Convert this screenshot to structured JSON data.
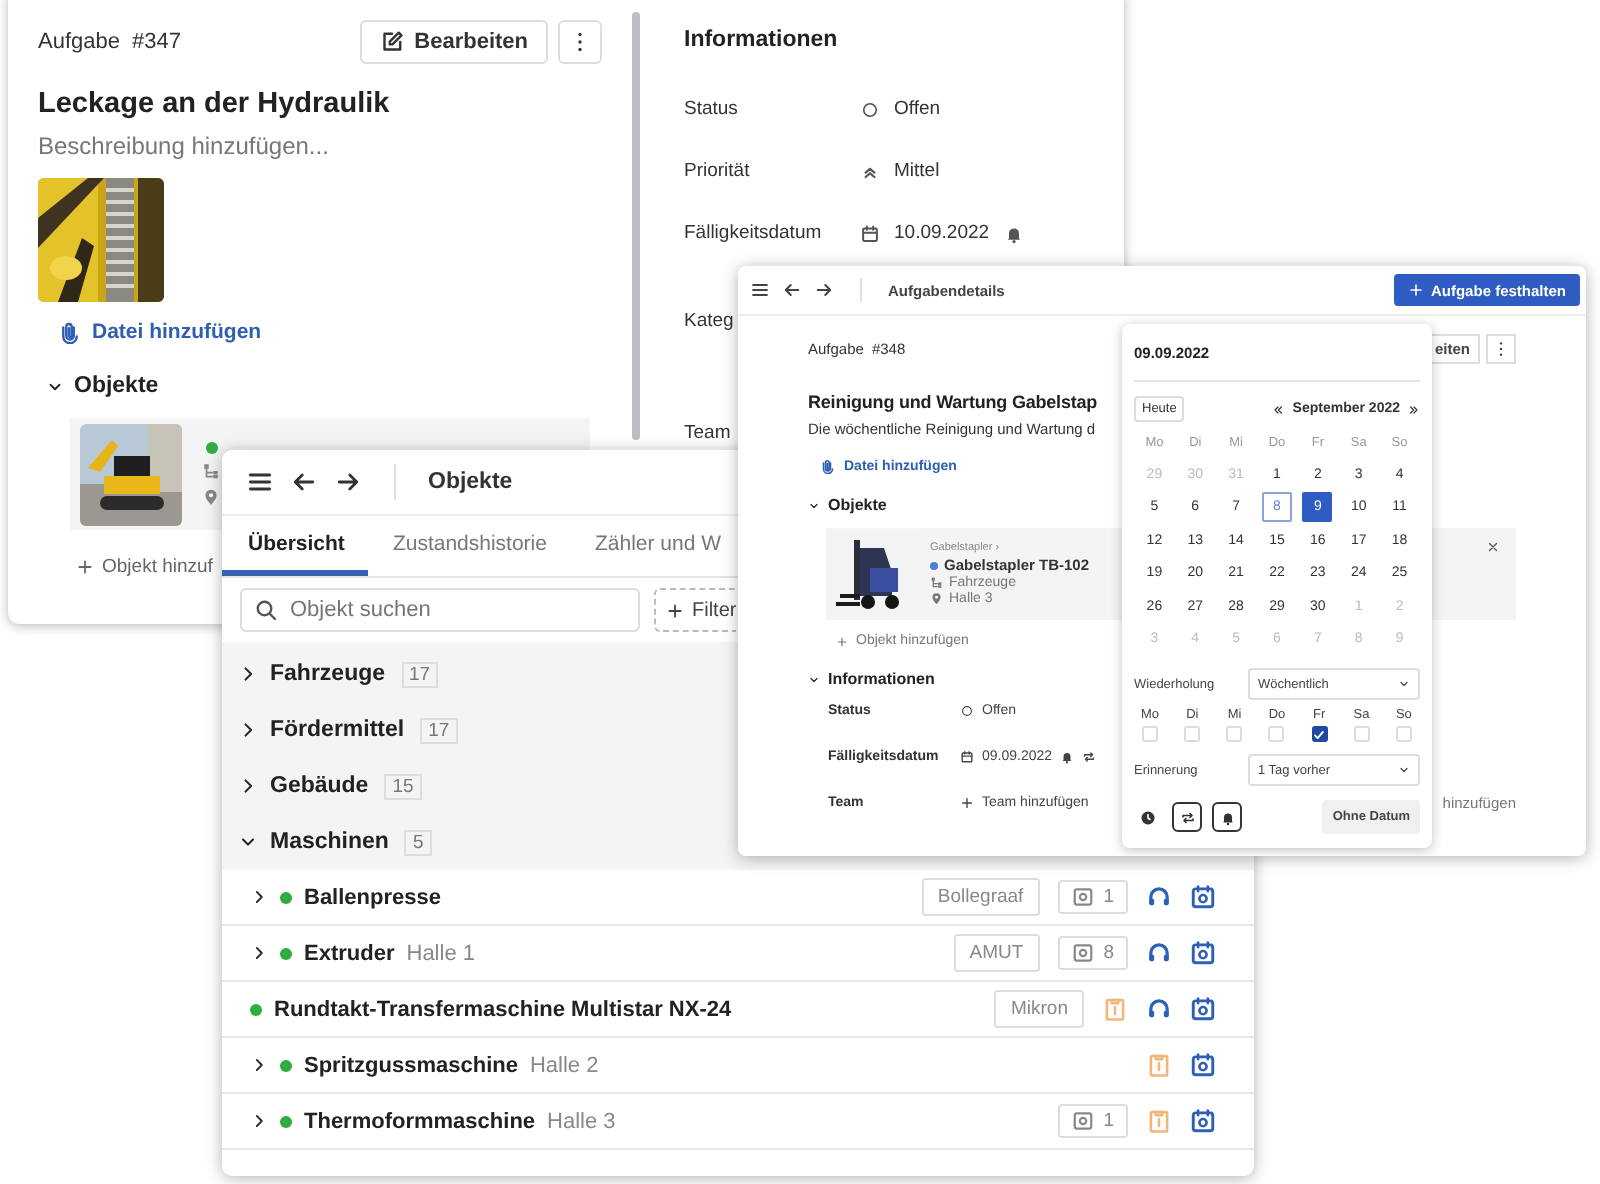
{
  "task_window": {
    "task_label": "Aufgabe",
    "task_number": "#347",
    "edit_button": "Bearbeiten",
    "title": "Leckage an der Hydraulik",
    "description_placeholder": "Beschreibung hinzufügen...",
    "add_file": "Datei hinzufügen",
    "objects_title": "Objekte",
    "objects_expanded": true,
    "add_object": "Objekt hinzuf"
  },
  "info_panel": {
    "title": "Informationen",
    "fields": [
      {
        "label": "Status",
        "value": "Offen",
        "kind": "status"
      },
      {
        "label": "Priorität",
        "value": "Mittel",
        "kind": "priority"
      },
      {
        "label": "Fälligkeitsdatum",
        "value": "10.09.2022",
        "kind": "date"
      },
      {
        "label": "Kateg",
        "kind": "none"
      },
      {
        "label": "Team",
        "kind": "none"
      }
    ]
  },
  "objects_window": {
    "title": "Objekte",
    "tabs": [
      {
        "label": "Übersicht",
        "selected": true
      },
      {
        "label": "Zustandshistorie",
        "selected": false
      },
      {
        "label": "Zähler und W",
        "selected": false
      }
    ],
    "search": {
      "placeholder": "Objekt suchen"
    },
    "filter_button": "Filter",
    "groups": [
      {
        "name": "Fahrzeuge",
        "count": "17",
        "expanded": false
      },
      {
        "name": "Fördermittel",
        "count": "17",
        "expanded": false
      },
      {
        "name": "Gebäude",
        "count": "15",
        "expanded": false
      },
      {
        "name": "Maschinen",
        "count": "5",
        "expanded": true,
        "children": [
          {
            "name": "Ballenpresse",
            "expandable": true,
            "manufacturer": "Bollegraaf",
            "open_tasks": "1",
            "clipboard": false,
            "headset": true
          },
          {
            "name": "Extruder",
            "location": "Halle 1",
            "expandable": true,
            "manufacturer": "AMUT",
            "open_tasks": "8",
            "clipboard": false,
            "headset": true
          },
          {
            "name": "Rundtakt-Transfermaschine Multistar NX-24",
            "expandable": false,
            "manufacturer": "Mikron",
            "clipboard": true,
            "headset": true
          },
          {
            "name": "Spritzgussmaschine",
            "location": "Halle 2",
            "expandable": true,
            "clipboard": true,
            "headset": false
          },
          {
            "name": "Thermoformmaschine",
            "location": "Halle 3",
            "expandable": true,
            "open_tasks": "1",
            "clipboard": true,
            "headset": false
          }
        ]
      }
    ]
  },
  "details_window": {
    "title": "Aufgabendetails",
    "primary_button": "Aufgabe festhalten",
    "task_label": "Aufgabe",
    "task_number": "#348",
    "edit_button": "eiten",
    "task_title": "Reinigung und Wartung Gabelstap",
    "description": "Die wöchentliche Reinigung und Wartung d",
    "add_file": "Datei hinzufügen",
    "objects_title": "Objekte",
    "object": {
      "breadcrumb": "Gabelstapler ›",
      "name": "Gabelstapler TB-102",
      "category": "Fahrzeuge",
      "location": "Halle 3"
    },
    "add_object": "Objekt hinzufügen",
    "info_title": "Informationen",
    "fields": [
      {
        "label": "Status",
        "value": "Offen",
        "kind": "status"
      },
      {
        "label": "Fälligkeitsdatum",
        "value": "09.09.2022",
        "kind": "date"
      },
      {
        "label": "Team",
        "value": "Team hinzufügen",
        "kind": "add",
        "side_link": "hinzufügen"
      }
    ]
  },
  "date_picker": {
    "value": "09.09.2022",
    "today_button": "Heute",
    "month": "September 2022",
    "weekdays": [
      "Mo",
      "Di",
      "Mi",
      "Do",
      "Fr",
      "Sa",
      "So"
    ],
    "days": [
      {
        "day": "29",
        "outside": true,
        "today": false,
        "selected": false
      },
      {
        "day": "30",
        "outside": true,
        "today": false,
        "selected": false
      },
      {
        "day": "31",
        "outside": true,
        "today": false,
        "selected": false
      },
      {
        "day": "1",
        "outside": false,
        "today": false,
        "selected": false
      },
      {
        "day": "2",
        "outside": false,
        "today": false,
        "selected": false
      },
      {
        "day": "3",
        "outside": false,
        "today": false,
        "selected": false
      },
      {
        "day": "4",
        "outside": false,
        "today": false,
        "selected": false
      },
      {
        "day": "5",
        "outside": false,
        "today": false,
        "selected": false
      },
      {
        "day": "6",
        "outside": false,
        "today": false,
        "selected": false
      },
      {
        "day": "7",
        "outside": false,
        "today": false,
        "selected": false
      },
      {
        "day": "8",
        "outside": false,
        "today": true,
        "selected": false
      },
      {
        "day": "9",
        "outside": false,
        "today": false,
        "selected": true
      },
      {
        "day": "10",
        "outside": false,
        "today": false,
        "selected": false
      },
      {
        "day": "11",
        "outside": false,
        "today": false,
        "selected": false
      },
      {
        "day": "12",
        "outside": false,
        "today": false,
        "selected": false
      },
      {
        "day": "13",
        "outside": false,
        "today": false,
        "selected": false
      },
      {
        "day": "14",
        "outside": false,
        "today": false,
        "selected": false
      },
      {
        "day": "15",
        "outside": false,
        "today": false,
        "selected": false
      },
      {
        "day": "16",
        "outside": false,
        "today": false,
        "selected": false
      },
      {
        "day": "17",
        "outside": false,
        "today": false,
        "selected": false
      },
      {
        "day": "18",
        "outside": false,
        "today": false,
        "selected": false
      },
      {
        "day": "19",
        "outside": false,
        "today": false,
        "selected": false
      },
      {
        "day": "20",
        "outside": false,
        "today": false,
        "selected": false
      },
      {
        "day": "21",
        "outside": false,
        "today": false,
        "selected": false
      },
      {
        "day": "22",
        "outside": false,
        "today": false,
        "selected": false
      },
      {
        "day": "23",
        "outside": false,
        "today": false,
        "selected": false
      },
      {
        "day": "24",
        "outside": false,
        "today": false,
        "selected": false
      },
      {
        "day": "25",
        "outside": false,
        "today": false,
        "selected": false
      },
      {
        "day": "26",
        "outside": false,
        "today": false,
        "selected": false
      },
      {
        "day": "27",
        "outside": false,
        "today": false,
        "selected": false
      },
      {
        "day": "28",
        "outside": false,
        "today": false,
        "selected": false
      },
      {
        "day": "29",
        "outside": false,
        "today": false,
        "selected": false
      },
      {
        "day": "30",
        "outside": false,
        "today": false,
        "selected": false
      },
      {
        "day": "1",
        "outside": true,
        "today": false,
        "selected": false
      },
      {
        "day": "2",
        "outside": true,
        "today": false,
        "selected": false
      },
      {
        "day": "3",
        "outside": true,
        "today": false,
        "selected": false
      },
      {
        "day": "4",
        "outside": true,
        "today": false,
        "selected": false
      },
      {
        "day": "5",
        "outside": true,
        "today": false,
        "selected": false
      },
      {
        "day": "6",
        "outside": true,
        "today": false,
        "selected": false
      },
      {
        "day": "7",
        "outside": true,
        "today": false,
        "selected": false
      },
      {
        "day": "8",
        "outside": true,
        "today": false,
        "selected": false
      },
      {
        "day": "9",
        "outside": true,
        "today": false,
        "selected": false
      }
    ],
    "repeat_label": "Wiederholung",
    "repeat_value": "Wöchentlich",
    "repeat_days": [
      {
        "label": "Mo",
        "checked": false
      },
      {
        "label": "Di",
        "checked": false
      },
      {
        "label": "Mi",
        "checked": false
      },
      {
        "label": "Do",
        "checked": false
      },
      {
        "label": "Fr",
        "checked": true
      },
      {
        "label": "Sa",
        "checked": false
      },
      {
        "label": "So",
        "checked": false
      }
    ],
    "reminder_label": "Erinnerung",
    "reminder_value": "1 Tag vorher",
    "no_date_button": "Ohne Datum"
  }
}
